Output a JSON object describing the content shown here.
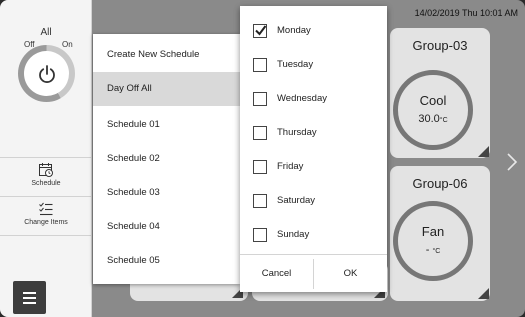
{
  "status_bar": {
    "datetime": "14/02/2019 Thu 10:01 AM"
  },
  "sidebar": {
    "all_label": "All",
    "off_label": "Off",
    "on_label": "On",
    "schedule_label": "Schedule",
    "change_items_label": "Change Items"
  },
  "groups": [
    {
      "name": "Group-03",
      "mode": "Cool",
      "temp": "30.0",
      "unit": "°C"
    },
    {
      "name": "Group-06",
      "mode": "Fan",
      "temp": "-",
      "unit": "°C"
    }
  ],
  "schedules": {
    "items": [
      {
        "label": "Create New Schedule",
        "selected": false
      },
      {
        "label": "Day Off All",
        "selected": true
      },
      {
        "label": "Schedule 01",
        "selected": false
      },
      {
        "label": "Schedule 02",
        "selected": false
      },
      {
        "label": "Schedule 03",
        "selected": false
      },
      {
        "label": "Schedule 04",
        "selected": false
      },
      {
        "label": "Schedule 05",
        "selected": false
      }
    ]
  },
  "day_picker": {
    "days": [
      {
        "label": "Monday",
        "checked": true
      },
      {
        "label": "Tuesday",
        "checked": false
      },
      {
        "label": "Wednesday",
        "checked": false
      },
      {
        "label": "Thursday",
        "checked": false
      },
      {
        "label": "Friday",
        "checked": false
      },
      {
        "label": "Saturday",
        "checked": false
      },
      {
        "label": "Sunday",
        "checked": false
      }
    ],
    "cancel_label": "Cancel",
    "ok_label": "OK"
  }
}
